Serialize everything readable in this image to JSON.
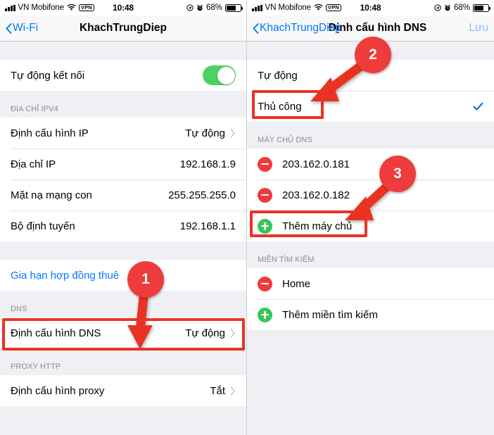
{
  "statusbar": {
    "carrier": "VN Mobifone",
    "vpn_label": "VPN",
    "time": "10:48",
    "battery_percent": "68%",
    "icons": [
      "signal-bars-icon",
      "wifi-icon",
      "vpn-badge-icon",
      "location-icon",
      "alarm-icon",
      "battery-icon"
    ]
  },
  "left_screen": {
    "nav": {
      "back_label": "Wi-Fi",
      "title": "KhachTrungDiep"
    },
    "auto_join": {
      "label": "Tự động kết nối",
      "toggle_on": true
    },
    "ipv4": {
      "header": "ĐỊA CHỈ IPV4",
      "rows": [
        {
          "label": "Định cấu hình IP",
          "value": "Tự động",
          "chevron": true
        },
        {
          "label": "Địa chỉ IP",
          "value": "192.168.1.9",
          "chevron": false
        },
        {
          "label": "Mặt nạ mạng con",
          "value": "255.255.255.0",
          "chevron": false
        },
        {
          "label": "Bộ định tuyến",
          "value": "192.168.1.1",
          "chevron": false
        }
      ]
    },
    "renew_lease": {
      "label": "Gia hạn hợp đồng thuê"
    },
    "dns": {
      "header": "DNS",
      "row": {
        "label": "Định cấu hình DNS",
        "value": "Tự động",
        "chevron": true
      }
    },
    "proxy": {
      "header": "PROXY HTTP",
      "row": {
        "label": "Định cấu hình proxy",
        "value": "Tắt",
        "chevron": true
      }
    }
  },
  "right_screen": {
    "nav": {
      "back_label": "KhachTrungDiep",
      "title": "Định cấu hình DNS",
      "save_label": "Lưu"
    },
    "mode": {
      "options": [
        {
          "label": "Tự động",
          "selected": false
        },
        {
          "label": "Thủ công",
          "selected": true
        }
      ]
    },
    "dns_servers": {
      "header": "MÁY CHỦ DNS",
      "rows": [
        {
          "icon": "minus-circle-icon",
          "label": "203.162.0.181"
        },
        {
          "icon": "minus-circle-icon",
          "label": "203.162.0.182"
        },
        {
          "icon": "plus-circle-icon",
          "label": "Thêm máy chủ"
        }
      ]
    },
    "search_domains": {
      "header": "MIỀN TÌM KIẾM",
      "rows": [
        {
          "icon": "minus-circle-icon",
          "label": "Home"
        },
        {
          "icon": "plus-circle-icon",
          "label": "Thêm miền tìm kiếm"
        }
      ]
    }
  },
  "annotations": {
    "accent_color": "#ea3323",
    "badges": [
      {
        "number": "1"
      },
      {
        "number": "2"
      },
      {
        "number": "3"
      }
    ]
  }
}
